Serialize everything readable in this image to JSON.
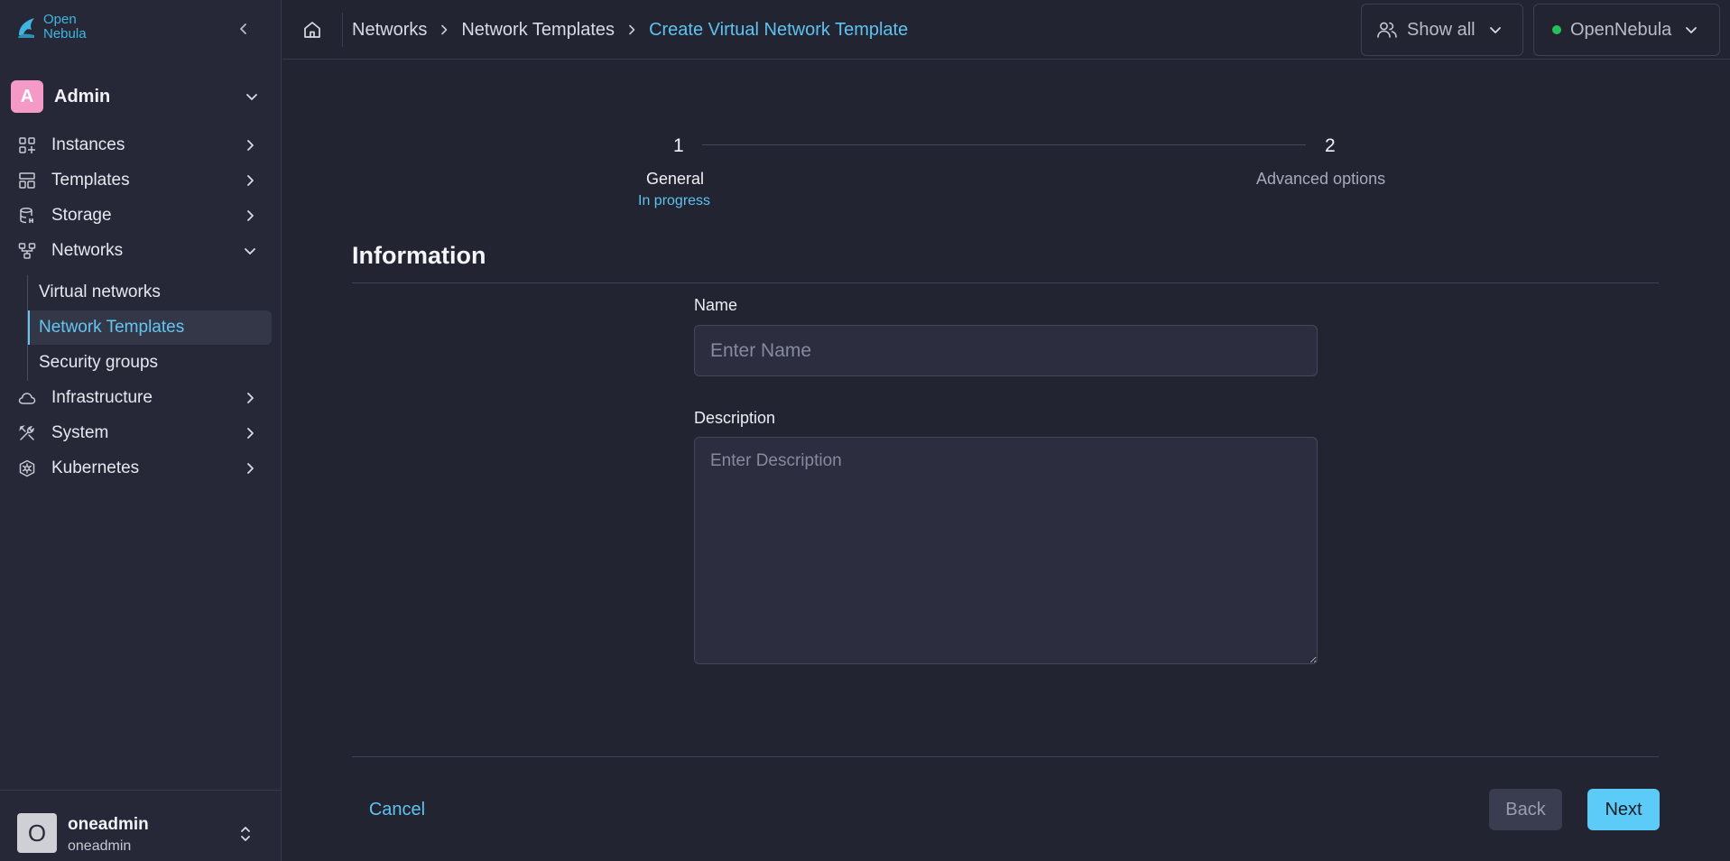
{
  "app": {
    "logo_line1": "Open",
    "logo_line2": "Nebula",
    "accent_color": "#5ec3f0",
    "logo_icon": "opennebula-logo-icon",
    "collapse_icon": "chevron-left-icon"
  },
  "sidebar": {
    "group": {
      "avatar_letter": "A",
      "avatar_color": "#f59ac7",
      "label": "Admin",
      "toggle_icon": "chevron-down-icon"
    },
    "items": [
      {
        "label": "Instances",
        "icon": "grid-plus-icon",
        "expanded": false
      },
      {
        "label": "Templates",
        "icon": "layout-icon",
        "expanded": false
      },
      {
        "label": "Storage",
        "icon": "database-icon",
        "expanded": false
      },
      {
        "label": "Networks",
        "icon": "network-icon",
        "expanded": true,
        "children": [
          {
            "label": "Virtual networks",
            "active": false
          },
          {
            "label": "Network Templates",
            "active": true
          },
          {
            "label": "Security groups",
            "active": false
          }
        ]
      },
      {
        "label": "Infrastructure",
        "icon": "cloud-icon",
        "expanded": false
      },
      {
        "label": "System",
        "icon": "tools-icon",
        "expanded": false
      },
      {
        "label": "Kubernetes",
        "icon": "kubernetes-icon",
        "expanded": false
      }
    ],
    "user": {
      "avatar_letter": "O",
      "name": "oneadmin",
      "group": "oneadmin",
      "toggle_icon": "chevron-up-down-icon"
    }
  },
  "topbar": {
    "home_icon": "home-icon",
    "breadcrumb": {
      "items": [
        "Networks",
        "Network Templates"
      ],
      "current": "Create Virtual Network Template",
      "separator_icon": "chevron-right-icon"
    },
    "group_filter": {
      "icon": "users-icon",
      "label": "Show all"
    },
    "zone": {
      "label": "OpenNebula",
      "status_color": "#26c05a"
    }
  },
  "stepper": {
    "steps": [
      {
        "number": "1",
        "title": "General",
        "status": "In progress"
      },
      {
        "number": "2",
        "title": "Advanced options",
        "status": ""
      }
    ]
  },
  "form": {
    "section_title": "Information",
    "name": {
      "label": "Name",
      "placeholder": "Enter Name",
      "value": ""
    },
    "description": {
      "label": "Description",
      "placeholder": "Enter Description",
      "value": ""
    }
  },
  "actions": {
    "cancel": "Cancel",
    "back": "Back",
    "next": "Next"
  }
}
